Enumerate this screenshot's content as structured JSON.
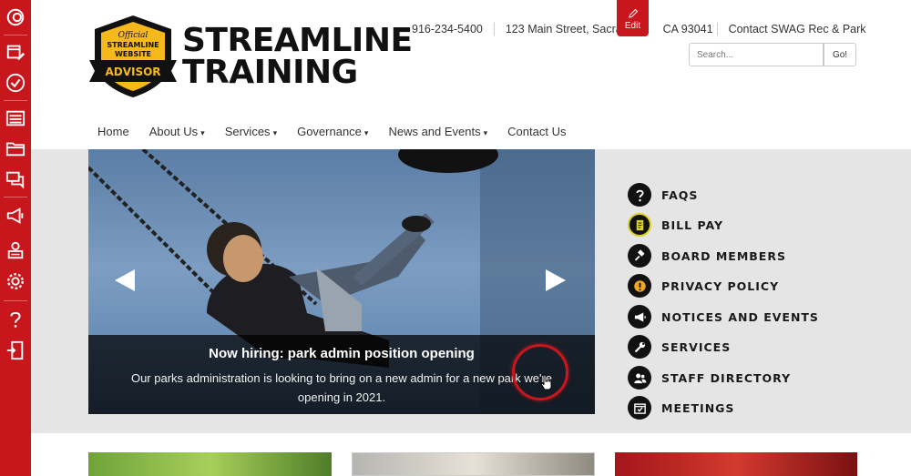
{
  "toolbar": {
    "items": [
      "logo-swirl-icon",
      "calendar-edit-icon",
      "checkmark-circle-icon",
      "list-icon",
      "folder-icon",
      "chat-icon",
      "megaphone-icon",
      "user-form-icon",
      "settings-gear-icon",
      "help-question-icon",
      "logout-door-icon"
    ]
  },
  "logo": {
    "badge_line1": "Official",
    "badge_line2": "STREAMLINE",
    "badge_line3": "WEBSITE",
    "badge_ribbon": "ADVISOR",
    "title_line1": "STREAMLINE",
    "title_line2": "TRAINING"
  },
  "header": {
    "phone": "916-234-5400",
    "address": "123 Main Street, Sacran",
    "address_tail": "CA 93041",
    "contact_link": "Contact SWAG Rec & Park",
    "edit_label": "Edit",
    "search_placeholder": "Search...",
    "search_button": "Go!"
  },
  "nav": {
    "items": [
      {
        "label": "Home",
        "dropdown": false
      },
      {
        "label": "About Us",
        "dropdown": true
      },
      {
        "label": "Services",
        "dropdown": true
      },
      {
        "label": "Governance",
        "dropdown": true
      },
      {
        "label": "News and Events",
        "dropdown": true
      },
      {
        "label": "Contact Us",
        "dropdown": false
      }
    ]
  },
  "slider": {
    "caption_title": "Now hiring: park admin position opening",
    "caption_text": "Our parks administration is looking to bring on a new admin for a new park we're opening in 2021."
  },
  "quick_links": [
    {
      "label": "FAQS",
      "icon": "question-icon",
      "icon_bg": "#111111"
    },
    {
      "label": "BILL PAY",
      "icon": "bill-icon",
      "icon_bg": "#d9d21e"
    },
    {
      "label": "BOARD MEMBERS",
      "icon": "gavel-icon",
      "icon_bg": "#111111"
    },
    {
      "label": "PRIVACY POLICY",
      "icon": "alert-icon",
      "icon_bg": "#f2a81d"
    },
    {
      "label": "NOTICES AND EVENTS",
      "icon": "megaphone-icon",
      "icon_bg": "#111111"
    },
    {
      "label": "SERVICES",
      "icon": "wrench-icon",
      "icon_bg": "#111111"
    },
    {
      "label": "STAFF DIRECTORY",
      "icon": "users-icon",
      "icon_bg": "#111111"
    },
    {
      "label": "MEETINGS",
      "icon": "calendar-check-icon",
      "icon_bg": "#111111"
    }
  ],
  "colors": {
    "brand_red": "#c8161d",
    "badge_yellow": "#f5b91c",
    "band_grey": "#e5e5e5"
  }
}
